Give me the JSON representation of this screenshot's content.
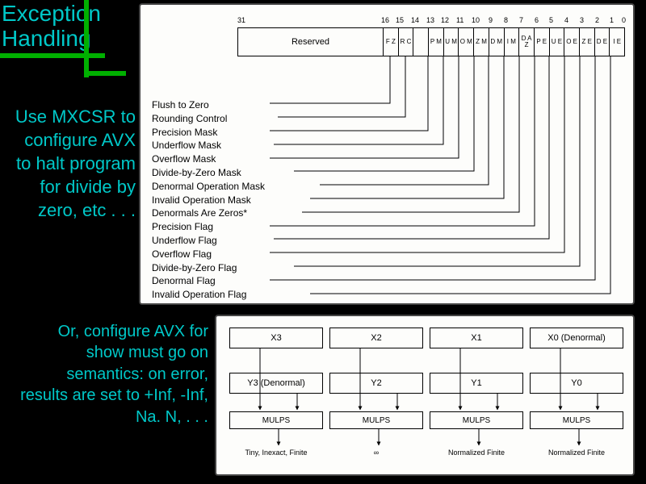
{
  "title_line1": "Exception",
  "title_line2": "Handling",
  "para1": "Use MXCSR to configure AVX to halt program for divide by zero, etc . . .",
  "para2": "Or, configure AVX for show must go on semantics: on error, results are set to +Inf, -Inf, Na. N, . . .",
  "mxcsr": {
    "reserved": "Reserved",
    "bit31": "31",
    "bitlabels": [
      "16",
      "15",
      "14",
      "13",
      "12",
      "11",
      "10",
      "9",
      "8",
      "7",
      "6",
      "5",
      "4",
      "3",
      "2",
      "1",
      "0"
    ],
    "bits": [
      "F Z",
      "R C",
      "",
      "P M",
      "U M",
      "O M",
      "Z M",
      "D M",
      "I M",
      "D A Z",
      "P E",
      "U E",
      "O E",
      "Z E",
      "D E",
      "I E"
    ],
    "labels": [
      "Flush to Zero",
      "Rounding Control",
      "Precision Mask",
      "Underflow Mask",
      "Overflow Mask",
      "Divide-by-Zero Mask",
      "Denormal Operation Mask",
      "Invalid Operation Mask",
      "Denormals Are Zeros*",
      "Precision Flag",
      "Underflow Flag",
      "Overflow Flag",
      "Divide-by-Zero Flag",
      "Denormal Flag",
      "Invalid Operation Flag"
    ]
  },
  "mulps": {
    "x": [
      "X3",
      "X2",
      "X1",
      "X0 (Denormal)"
    ],
    "y": [
      "Y3 (Denormal)",
      "Y2",
      "Y1",
      "Y0"
    ],
    "op": [
      "MULPS",
      "MULPS",
      "MULPS",
      "MULPS"
    ],
    "res": [
      "Tiny, Inexact, Finite",
      "∞",
      "Normalized Finite",
      "Normalized Finite"
    ]
  }
}
